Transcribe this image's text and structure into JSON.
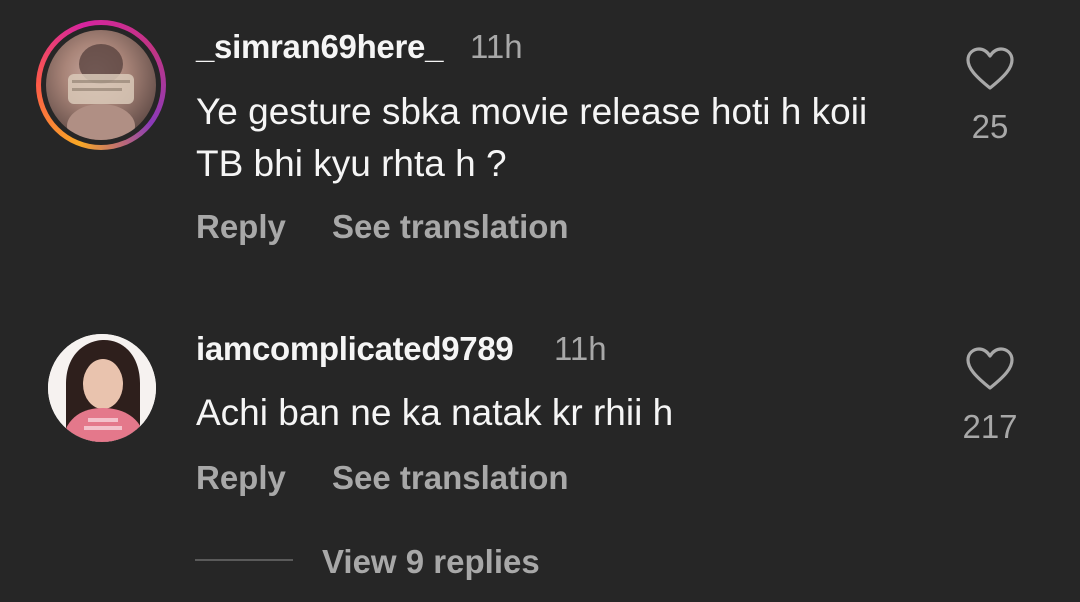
{
  "comments": [
    {
      "username": "_simran69here_",
      "time": "11h",
      "text": "Ye gesture sbka movie release hoti h koii TB bhi kyu rhta h ?",
      "likes": "25",
      "reply_label": "Reply",
      "translate_label": "See translation",
      "has_story_ring": true
    },
    {
      "username": "iamcomplicated9789",
      "time": "11h",
      "text": "Achi ban ne ka natak kr rhii h",
      "likes": "217",
      "reply_label": "Reply",
      "translate_label": "See translation",
      "has_story_ring": false
    }
  ],
  "view_replies_label": "View 9 replies",
  "colors": {
    "background": "#262626",
    "primary_text": "#f5f5f5",
    "secondary_text": "#a8a8a8"
  },
  "icons": {
    "like": "heart-outline-icon"
  }
}
